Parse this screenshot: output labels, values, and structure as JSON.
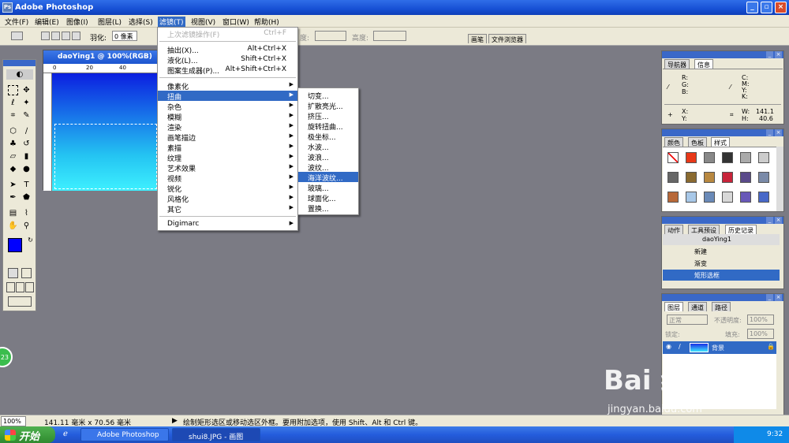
{
  "window": {
    "title": "Adobe Photoshop"
  },
  "menubar": [
    {
      "label": "文件(F)"
    },
    {
      "label": "编辑(E)"
    },
    {
      "label": "图像(I)"
    },
    {
      "label": "图层(L)"
    },
    {
      "label": "选择(S)"
    },
    {
      "label": "滤镜(T)"
    },
    {
      "label": "视图(V)"
    },
    {
      "label": "窗口(W)"
    },
    {
      "label": "帮助(H)"
    }
  ],
  "options": {
    "feather_label": "羽化:",
    "feather_value": "0 像素",
    "ratio_label": "度:",
    "height_label": "高度:",
    "brush_tab": "画笔",
    "browser_tab": "文件浏览器"
  },
  "document": {
    "title": "daoYing1 @ 100%(RGB)",
    "ruler": [
      "0",
      "20",
      "40"
    ]
  },
  "filter_menu": [
    {
      "label": "上次滤镜操作(F)",
      "shortcut": "Ctrl+F",
      "disabled": true
    },
    {
      "sep": true
    },
    {
      "label": "抽出(X)...",
      "shortcut": "Alt+Ctrl+X"
    },
    {
      "label": "液化(L)...",
      "shortcut": "Shift+Ctrl+X"
    },
    {
      "label": "图案生成器(P)...",
      "shortcut": "Alt+Shift+Ctrl+X"
    },
    {
      "sep": true
    },
    {
      "label": "像素化",
      "sub": true
    },
    {
      "label": "扭曲",
      "sub": true,
      "highlight": true
    },
    {
      "label": "杂色",
      "sub": true
    },
    {
      "label": "模糊",
      "sub": true
    },
    {
      "label": "渲染",
      "sub": true
    },
    {
      "label": "画笔描边",
      "sub": true
    },
    {
      "label": "素描",
      "sub": true
    },
    {
      "label": "纹理",
      "sub": true
    },
    {
      "label": "艺术效果",
      "sub": true
    },
    {
      "label": "视频",
      "sub": true
    },
    {
      "label": "锐化",
      "sub": true
    },
    {
      "label": "风格化",
      "sub": true
    },
    {
      "label": "其它",
      "sub": true
    },
    {
      "sep": true
    },
    {
      "label": "Digimarc",
      "sub": true
    }
  ],
  "distort_menu": [
    {
      "label": "切变..."
    },
    {
      "label": "扩散亮光..."
    },
    {
      "label": "挤压..."
    },
    {
      "label": "旋转扭曲..."
    },
    {
      "label": "极坐标..."
    },
    {
      "label": "水波..."
    },
    {
      "label": "波浪..."
    },
    {
      "label": "波纹..."
    },
    {
      "label": "海洋波纹...",
      "highlight": true
    },
    {
      "label": "玻璃..."
    },
    {
      "label": "球面化..."
    },
    {
      "label": "置换..."
    }
  ],
  "nav_panel": {
    "tabs": [
      "导航器",
      "信息"
    ],
    "rgb": [
      "R:",
      "G:",
      "B:"
    ],
    "cmyk": [
      "C:",
      "M:",
      "Y:",
      "K:"
    ],
    "xy": [
      "X:",
      "Y:"
    ],
    "w_label": "W:",
    "h_label": "H:",
    "w": "141.1",
    "h": "40.6"
  },
  "color_panel": {
    "tabs": [
      "颜色",
      "色板",
      "样式"
    ]
  },
  "history_panel": {
    "tabs": [
      "动作",
      "工具预设",
      "历史记录"
    ],
    "snapshot": "daoYing1",
    "rows": [
      "新建",
      "渐变",
      "矩形选框"
    ]
  },
  "layers_panel": {
    "tabs": [
      "图层",
      "通道",
      "路径"
    ],
    "mode": "正常",
    "opacity_label": "不透明度:",
    "opacity": "100%",
    "lock_label": "锁定:",
    "fill_label": "填充:",
    "fill": "100%",
    "layer_name": "背景"
  },
  "status": {
    "zoom": "100%",
    "size": "141.11 毫米 x 70.56 毫米",
    "hint": "绘制矩形选区或移动选区外框。要用附加选项，使用 Shift、Alt 和 Ctrl 键。"
  },
  "taskbar": {
    "start": "开始",
    "items": [
      "Adobe Photoshop",
      "shui8.JPG - 画图"
    ],
    "time": "9:32"
  },
  "watermark": {
    "text": "Bai 经验",
    "url": "jingyan.baidu.com"
  },
  "badge": "23",
  "colors": {
    "fg": "#0000ff",
    "bg": "#55e6ff",
    "highlight": "#316ac5"
  }
}
